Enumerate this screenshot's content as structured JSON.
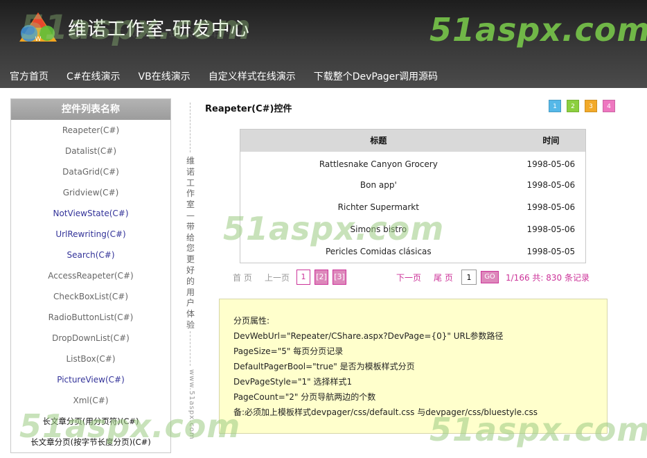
{
  "header": {
    "site_title": "维诺工作室-研发中心",
    "brand_watermark": "51aspx.com"
  },
  "nav": [
    {
      "label": "官方首页"
    },
    {
      "label": "C#在线演示"
    },
    {
      "label": "VB在线演示"
    },
    {
      "label": "自定义样式在线演示"
    },
    {
      "label": "下载整个DevPager调用源码"
    }
  ],
  "sidebar": {
    "title": "控件列表名称",
    "items": [
      {
        "label": "Reapeter(C#)"
      },
      {
        "label": "Datalist(C#)"
      },
      {
        "label": "DataGrid(C#)"
      },
      {
        "label": "Gridview(C#)"
      },
      {
        "label": "NotViewState(C#)"
      },
      {
        "label": "UrlRewriting(C#)"
      },
      {
        "label": "Search(C#)"
      },
      {
        "label": "AccessReapeter(C#)"
      },
      {
        "label": "CheckBoxList(C#)"
      },
      {
        "label": "RadioButtonList(C#)"
      },
      {
        "label": "DropDownList(C#)"
      },
      {
        "label": "ListBox(C#)"
      },
      {
        "label": "PictureView(C#)"
      },
      {
        "label": "Xml(C#)"
      },
      {
        "label": "长文章分页(用分页符)(C#)"
      },
      {
        "label": "长文章分页(按字节长度分页)(C#)"
      }
    ]
  },
  "divider": {
    "vertical_text": "维诺工作室—带给您更好的用户体验",
    "url_text": "www.51aspx.com"
  },
  "main": {
    "title": "Reapeter(C#)控件",
    "style_buttons": [
      {
        "label": "1",
        "color": "#55b8e8"
      },
      {
        "label": "2",
        "color": "#8ccf3f"
      },
      {
        "label": "3",
        "color": "#f2aa2a"
      },
      {
        "label": "4",
        "color": "#ee77c0"
      }
    ]
  },
  "table": {
    "headers": [
      "标题",
      "时间"
    ],
    "rows": [
      {
        "title": "Rattlesnake Canyon Grocery",
        "date": "1998-05-06"
      },
      {
        "title": "Bon app'",
        "date": "1998-05-06"
      },
      {
        "title": "Richter Supermarkt",
        "date": "1998-05-06"
      },
      {
        "title": "Simons bistro",
        "date": "1998-05-06"
      },
      {
        "title": "Pericles Comidas clásicas",
        "date": "1998-05-05"
      }
    ]
  },
  "pager": {
    "first": "首 页",
    "prev": "上一页",
    "current": "1",
    "pages": [
      "[2]",
      "[3]"
    ],
    "next": "下一页",
    "last": "尾 页",
    "input_value": "1",
    "go": "GO",
    "info": "1/166 共: 830 条记录"
  },
  "properties": {
    "lines": [
      "分页属性:",
      "DevWebUrl=\"Repeater/CShare.aspx?DevPage={0}\" URL参数路径",
      "PageSize=\"5\" 每页分页记录",
      "DefaultPagerBool=\"true\" 是否为模板样式分页",
      "DevPageStyle=\"1\" 选择样式1",
      "PageCount=\"2\" 分页导航两边的个数",
      "备:必须加上模板样式devpager/css/default.css 与devpager/css/bluestyle.css"
    ]
  },
  "watermark": {
    "text": "51aspx.com"
  }
}
